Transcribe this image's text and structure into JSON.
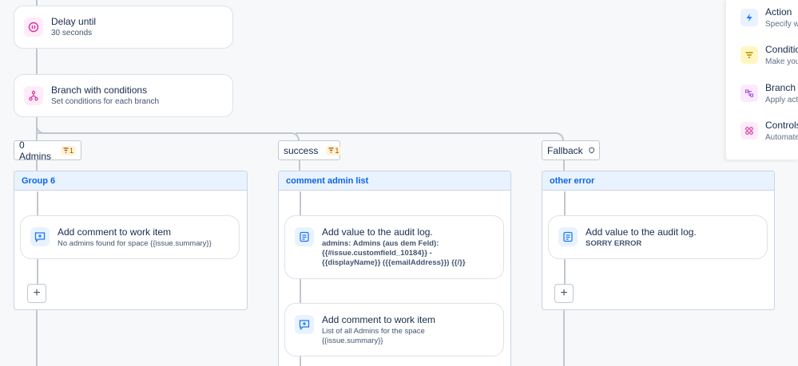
{
  "flow": {
    "delay": {
      "title": "Delay until",
      "subtitle": "30 seconds"
    },
    "branch": {
      "title": "Branch with conditions",
      "subtitle": "Set conditions for each branch"
    }
  },
  "branches": [
    {
      "label": "0 Admins",
      "filter_count": "1"
    },
    {
      "label": "success",
      "filter_count": "1"
    },
    {
      "label": "Fallback"
    }
  ],
  "groups": [
    {
      "title": "Group 6",
      "cards": [
        {
          "title": "Add comment to work item",
          "subtitle": "No admins found for space {{issue.summary}}"
        }
      ]
    },
    {
      "title": "comment admin list",
      "cards": [
        {
          "title": "Add value to the audit log.",
          "subtitle_lines": [
            "admins: Admins (aus dem Feld):",
            "{{#issue.customfield_10184}} -",
            "{{displayName}} ({{emailAddress}}) {{/}}"
          ]
        },
        {
          "title": "Add comment to work item",
          "subtitle_lines": [
            "List of all Admins for the space",
            "{{issue.summary}}"
          ]
        }
      ]
    },
    {
      "title": "other error",
      "cards": [
        {
          "title": "Add value to the audit log.",
          "subtitle": "SORRY ERROR"
        }
      ]
    }
  ],
  "add_label": "+",
  "panel": {
    "items": [
      {
        "title": "Action",
        "subtitle": "Specify w",
        "icon": "lightning-icon",
        "color": "#e9f2ff",
        "fg": "#1d7afc"
      },
      {
        "title": "Conditio",
        "subtitle": "Make you",
        "icon": "filter-icon",
        "color": "#fff7c2",
        "fg": "#b38600"
      },
      {
        "title": "Branch",
        "subtitle": "Apply act",
        "icon": "branch-icon",
        "color": "#fbeaff",
        "fg": "#a74fd9"
      },
      {
        "title": "Controls",
        "subtitle": "Automate",
        "icon": "controls-icon",
        "color": "#ffecf8",
        "fg": "#d4349c"
      }
    ]
  },
  "colors": {
    "accent": "#0c66e4",
    "group_header_bg": "#e9f2ff",
    "connector": "#c1c7d0"
  }
}
